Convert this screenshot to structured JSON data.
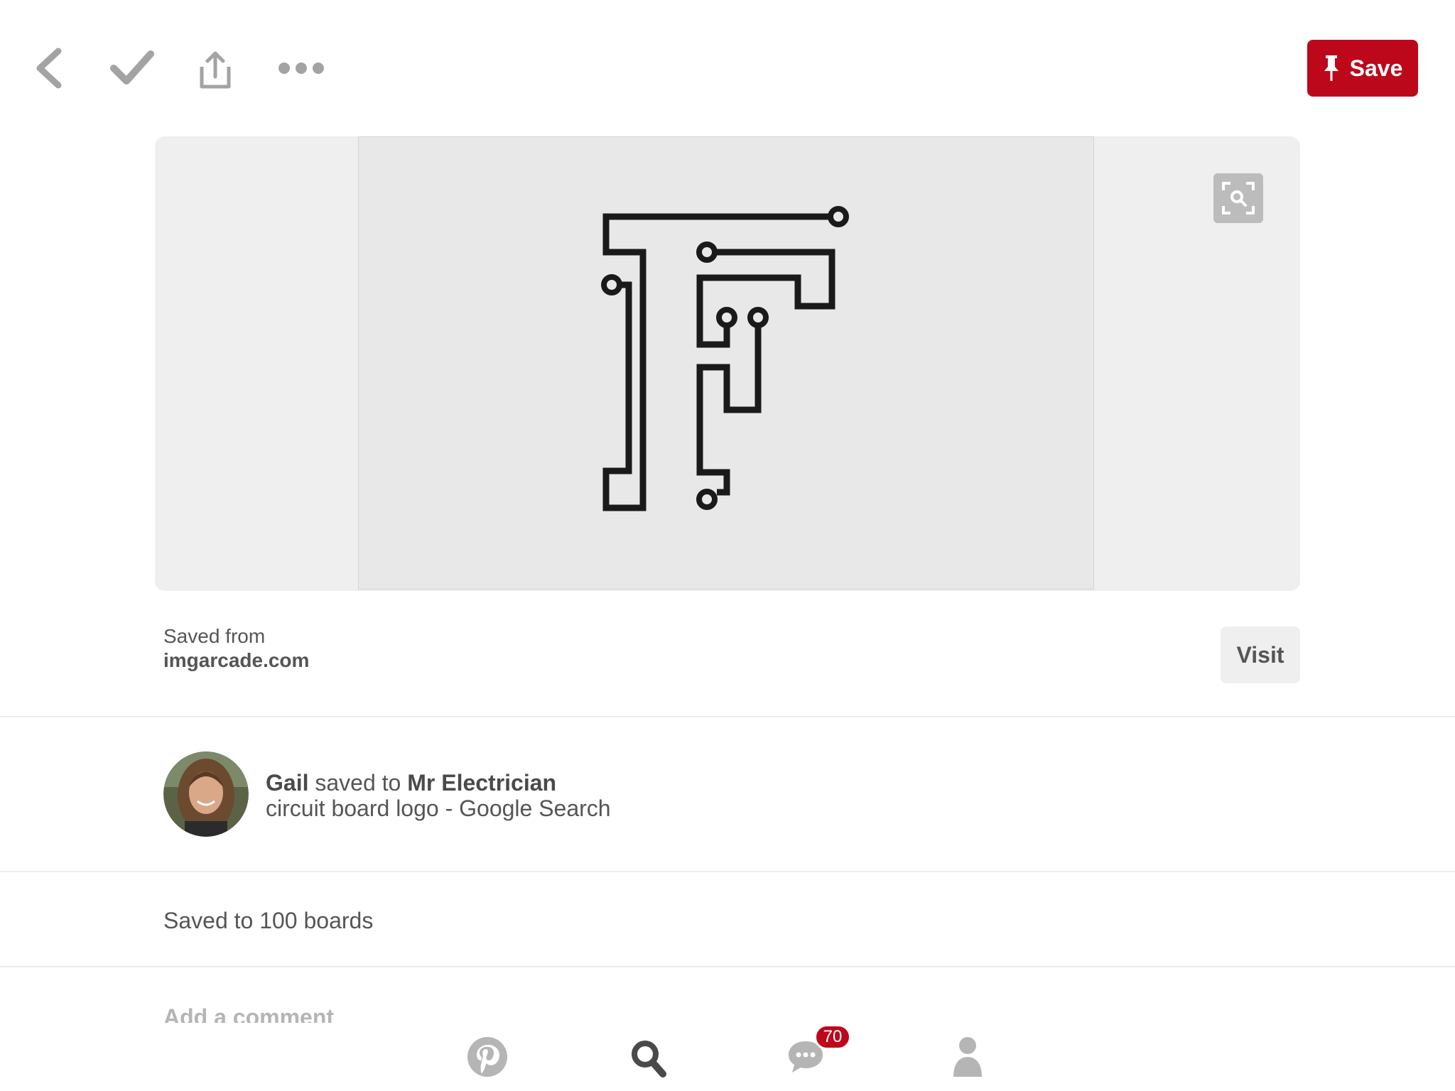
{
  "toolbar": {
    "back_icon": "chevron-left-icon",
    "done_icon": "checkmark-icon",
    "share_icon": "share-icon",
    "more_icon": "more-dots-icon",
    "save_label": "Save",
    "save_icon": "pushpin-icon"
  },
  "colors": {
    "brand_red": "#bd081c",
    "icon_gray": "#a3a3a3",
    "text_gray": "#555555"
  },
  "pin": {
    "image_icon": "visual-search-icon",
    "saved_from_label": "Saved from",
    "source_domain": "imgarcade.com",
    "visit_label": "Visit"
  },
  "pinner": {
    "name": "Gail",
    "action_text": "saved to",
    "board": "Mr Electrician",
    "description": "circuit board logo - Google Search"
  },
  "saved_count_text": "Saved to 100 boards",
  "comment": {
    "placeholder": "Add a comment"
  },
  "bottom_nav": {
    "home_icon": "pinterest-logo-icon",
    "search_icon": "search-icon",
    "messages_icon": "chat-bubble-icon",
    "notification_count": "70",
    "profile_icon": "person-icon"
  }
}
